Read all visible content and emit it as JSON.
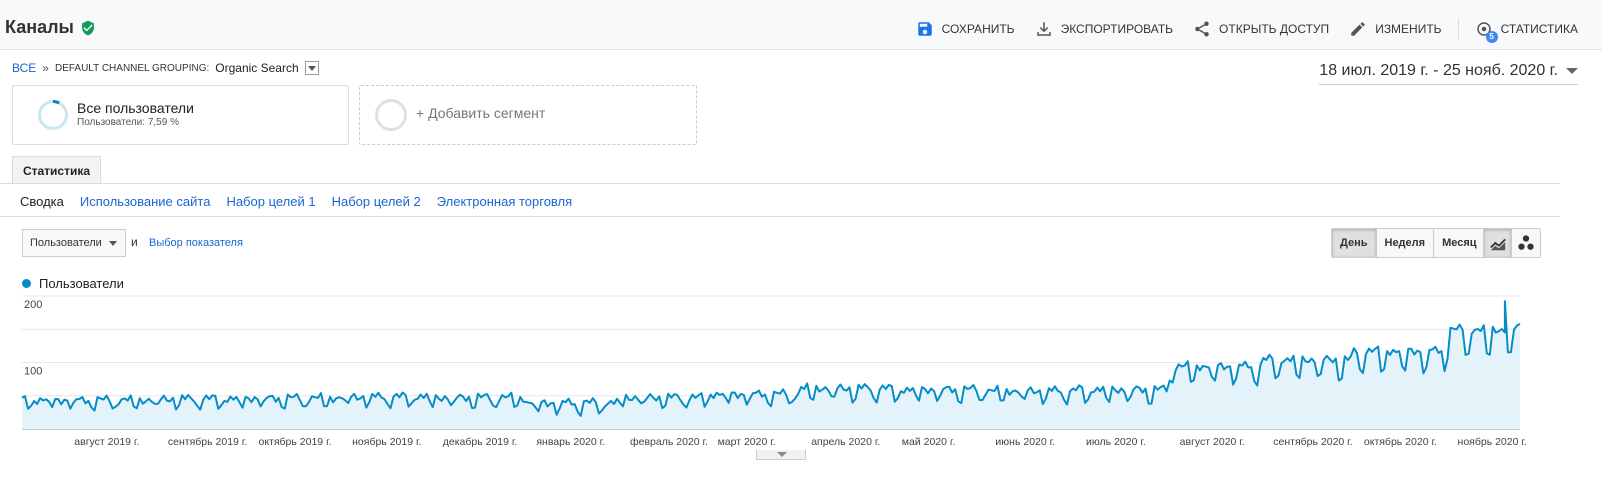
{
  "header": {
    "title": "Каналы",
    "actions": [
      {
        "label": "СОХРАНИТЬ",
        "icon": "save-icon"
      },
      {
        "label": "ЭКСПОРТИРОВАТЬ",
        "icon": "download-icon"
      },
      {
        "label": "ОТКРЫТЬ ДОСТУП",
        "icon": "share-icon"
      },
      {
        "label": "ИЗМЕНИТЬ",
        "icon": "pencil-icon"
      },
      {
        "label": "СТАТИСТИКА",
        "icon": "insights-icon",
        "badge": "5"
      }
    ]
  },
  "breadcrumb": {
    "root": "ВСЕ",
    "separator": "»",
    "grouping_key": "DEFAULT CHANNEL GROUPING:",
    "grouping_value": "Organic Search"
  },
  "date_range": "18 июл. 2019 г. - 25 нояб. 2020 г.",
  "segments": {
    "active": {
      "title": "Все пользователи",
      "subtitle": "Пользователи: 7,59 %",
      "share": 0.0759
    },
    "add_label": "+ Добавить сегмент"
  },
  "tabs": {
    "main": "Статистика"
  },
  "subnav": [
    "Сводка",
    "Использование сайта",
    "Набор целей 1",
    "Набор целей 2",
    "Электронная торговля"
  ],
  "controls": {
    "metric": "Пользователи",
    "and": "и",
    "choose_metric": "Выбор показателя",
    "periods": [
      "День",
      "Неделя",
      "Месяц"
    ],
    "active_period": "День"
  },
  "legend": {
    "label": "Пользователи"
  },
  "colors": {
    "accent": "#058dc7",
    "fill": "#e4f2f9",
    "link": "#1967d2",
    "verified": "#0f9d58"
  },
  "chart_data": {
    "type": "area",
    "series": [
      {
        "name": "Пользователи",
        "granularity": "day"
      }
    ],
    "x_range": [
      "2019-07-18",
      "2020-11-25"
    ],
    "x_ticks": [
      "август 2019 г.",
      "сентябрь 2019 г.",
      "октябрь 2019 г.",
      "ноябрь 2019 г.",
      "декабрь 2019 г.",
      "январь 2020 г.",
      "февраль 2020 г.",
      "март 2020 г.",
      "апрель 2020 г.",
      "май 2020 г.",
      "июнь 2020 г.",
      "июль 2020 г.",
      "август 2020 г.",
      "сентябрь 2020 г.",
      "октябрь 2020 г.",
      "ноябрь 2020 г."
    ],
    "y_ticks": [
      100,
      200
    ],
    "ylim": [
      0,
      200
    ],
    "grid": true,
    "monthly_avg": [
      {
        "month": "2019-07",
        "weekday": 44,
        "weekend": 34
      },
      {
        "month": "2019-08",
        "weekday": 44,
        "weekend": 33
      },
      {
        "month": "2019-09",
        "weekday": 46,
        "weekend": 34
      },
      {
        "month": "2019-10",
        "weekday": 47,
        "weekend": 35
      },
      {
        "month": "2019-11",
        "weekday": 49,
        "weekend": 37
      },
      {
        "month": "2019-12",
        "weekday": 48,
        "weekend": 35
      },
      {
        "month": "2020-01",
        "weekday": 40,
        "weekend": 26
      },
      {
        "month": "2020-02",
        "weekday": 48,
        "weekend": 36
      },
      {
        "month": "2020-03",
        "weekday": 53,
        "weekend": 40
      },
      {
        "month": "2020-04",
        "weekday": 62,
        "weekend": 45
      },
      {
        "month": "2020-05",
        "weekday": 60,
        "weekend": 44
      },
      {
        "month": "2020-06",
        "weekday": 58,
        "weekend": 43
      },
      {
        "month": "2020-07",
        "weekday": 60,
        "weekend": 42
      },
      {
        "month": "2020-08",
        "weekday": 95,
        "weekend": 72
      },
      {
        "month": "2020-09",
        "weekday": 105,
        "weekend": 78
      },
      {
        "month": "2020-10",
        "weekday": 118,
        "weekend": 88
      },
      {
        "month": "2020-11",
        "weekday": 150,
        "weekend": 112
      }
    ],
    "peak": {
      "date": "2020-11-20",
      "value": 192
    },
    "last": {
      "date": "2020-11-25",
      "value": 158
    }
  }
}
